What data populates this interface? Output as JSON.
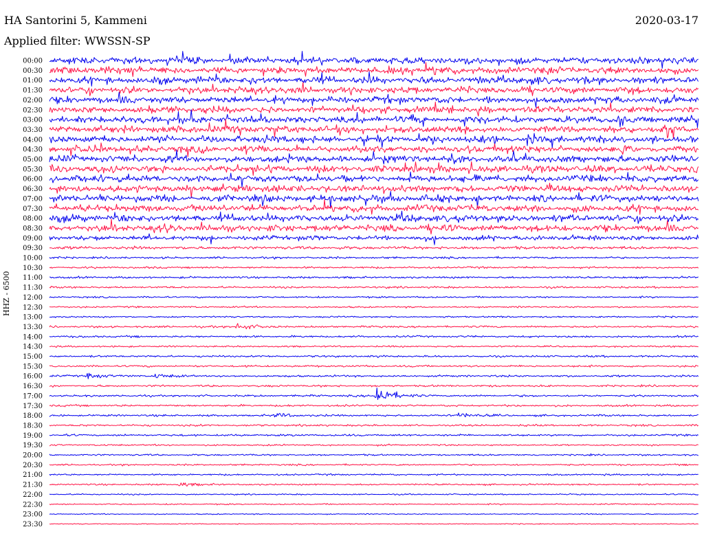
{
  "header": {
    "station": "HA Santorini 5, Kammeni",
    "date": "2020-03-17",
    "filter": "Applied filter: WWSSN-SP"
  },
  "channel_label": "HHZ - 6500",
  "colors": {
    "blue": "#0000ee",
    "red": "#ff1144"
  },
  "chart_data": {
    "type": "line",
    "title": "",
    "xlabel": "",
    "ylabel": "HHZ - 6500",
    "grid": false,
    "legend": "none",
    "trace_time_labels": [
      "00:00",
      "00:30",
      "01:00",
      "01:30",
      "02:00",
      "02:30",
      "03:00",
      "03:30",
      "04:00",
      "04:30",
      "05:00",
      "05:30",
      "06:00",
      "06:30",
      "07:00",
      "07:30",
      "08:00",
      "08:30",
      "09:00",
      "09:30",
      "10:00",
      "10:30",
      "11:00",
      "11:30",
      "12:00",
      "12:30",
      "13:00",
      "13:30",
      "14:00",
      "14:30",
      "15:00",
      "15:30",
      "16:00",
      "16:30",
      "17:00",
      "17:30",
      "18:00",
      "18:30",
      "19:00",
      "19:30",
      "20:00",
      "20:30",
      "21:00",
      "21:30",
      "22:00",
      "22:30",
      "23:00",
      "23:30"
    ],
    "trace_colors": [
      "blue",
      "red"
    ],
    "trace_duration_minutes": 30,
    "noise_amplitude_level": [
      1.0,
      1.0,
      1.0,
      1.0,
      1.0,
      1.0,
      1.0,
      1.0,
      1.0,
      1.0,
      1.0,
      1.0,
      1.0,
      1.0,
      1.0,
      1.0,
      1.0,
      1.0,
      0.7,
      0.45,
      0.3,
      0.3,
      0.3,
      0.3,
      0.25,
      0.25,
      0.25,
      0.3,
      0.3,
      0.25,
      0.3,
      0.3,
      0.3,
      0.3,
      0.3,
      0.3,
      0.3,
      0.3,
      0.3,
      0.25,
      0.25,
      0.25,
      0.25,
      0.25,
      0.2,
      0.2,
      0.15,
      0.15
    ],
    "events": [
      {
        "trace": "13:30",
        "position_fraction": 0.29,
        "amplitude_level": 1.0
      },
      {
        "trace": "16:00",
        "position_fraction": 0.06,
        "amplitude_level": 0.7
      },
      {
        "trace": "16:00",
        "position_fraction": 0.16,
        "amplitude_level": 0.6
      },
      {
        "trace": "17:00",
        "position_fraction": 0.505,
        "amplitude_level": 3.0
      },
      {
        "trace": "18:00",
        "position_fraction": 0.35,
        "amplitude_level": 0.6
      },
      {
        "trace": "18:00",
        "position_fraction": 0.63,
        "amplitude_level": 0.7
      },
      {
        "trace": "21:30",
        "position_fraction": 0.2,
        "amplitude_level": 0.6
      }
    ]
  }
}
